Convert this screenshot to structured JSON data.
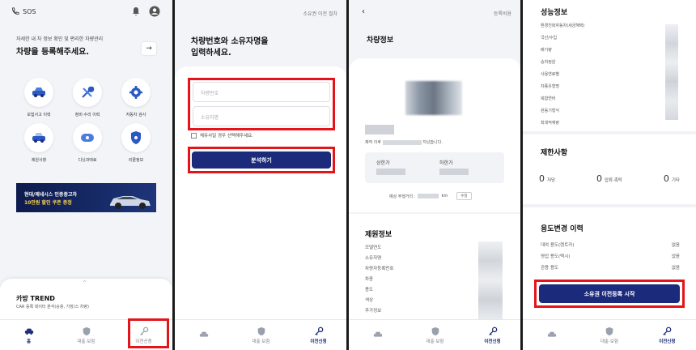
{
  "p1": {
    "sos": "SOS",
    "intro_small": "자세한 내 차 정보 확인 및 편리한 차량관리",
    "intro_big": "차량을 등록해주세요.",
    "services": [
      "보험사고 이력",
      "정비·수리 이력",
      "자동차 검사",
      "제원사항",
      "디닝과태료",
      "리콜정보"
    ],
    "banner_line1": "현대/제네시스 인증중고차",
    "banner_line2": "10만원 할인 쿠폰 증정",
    "trend_title": "카방 TREND",
    "trend_sub": "CAR 등록 데이터 분석(승용, 가장/스 차량)",
    "tabs": [
      "홈",
      "대출·보험",
      "이전신청"
    ]
  },
  "p2": {
    "top_link": "소유권 이전 절차",
    "heading_line1": "차량번호와 소유자명을",
    "heading_line2": "입력하세요.",
    "plate_placeholder": "차량번호",
    "owner_placeholder": "소유자명",
    "checkbox_label": "체유사일 경우 선택해주세요.",
    "analyze_button": "분석하기",
    "tabs": [
      "",
      "대출·보험",
      "이전신청"
    ]
  },
  "p3": {
    "top_link": "등록비용",
    "section_title": "차량정보",
    "caption": "제작 이후",
    "caption_tail": "지났습니다.",
    "upper_price_label": "상한가",
    "lower_price_label": "하한가",
    "mileage_label": "예상 주행거리 :",
    "mileage_unit": "km",
    "edit_button": "수정",
    "spec_title": "제원정보",
    "spec_items": [
      "모델연도",
      "소유자명",
      "차량자등록번호",
      "차종",
      "용도",
      "색상",
      "추가정보"
    ],
    "tabs": [
      "",
      "대출·보험",
      "이전신청"
    ]
  },
  "p4": {
    "perf_title": "성능정보",
    "perf_items": [
      "환경친화자동차(세금혜택)",
      "국산/수입",
      "배기량",
      "승차정원",
      "사용연료별",
      "차종유형명",
      "복합연비",
      "원동기형식",
      "최대적재량"
    ],
    "restrict_title": "제한사항",
    "restrict_items": [
      {
        "count": "0",
        "label": "저당"
      },
      {
        "count": "0",
        "label": "압류·촉탁"
      },
      {
        "count": "0",
        "label": "기타"
      }
    ],
    "usage_title": "용도변경 이력",
    "usage_rows": [
      {
        "label": "대여 용도(렌트카)",
        "value": "없음"
      },
      {
        "label": "영업 용도(택시)",
        "value": "없음"
      },
      {
        "label": "관용 용도",
        "value": "없음"
      }
    ],
    "start_button": "소유권 이전등록 시작",
    "tabs": [
      "",
      "대출·보험",
      "이전신청"
    ]
  },
  "colors": {
    "navy": "#1b2a7a",
    "highlight": "#e3151b"
  }
}
